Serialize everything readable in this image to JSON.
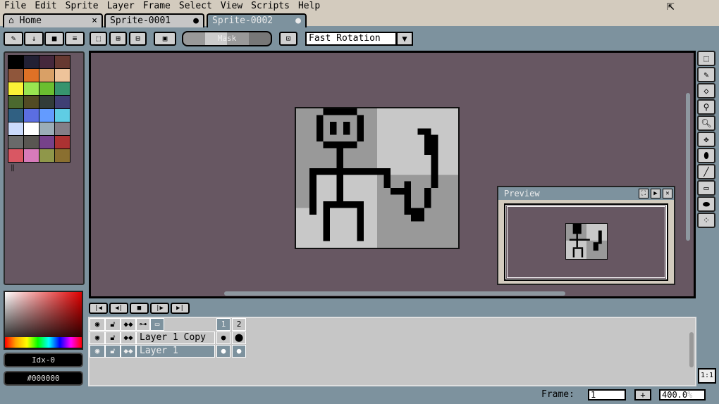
{
  "menu": [
    "File",
    "Edit",
    "Sprite",
    "Layer",
    "Frame",
    "Select",
    "View",
    "Scripts",
    "Help"
  ],
  "tabs": [
    {
      "label": "Home",
      "mark": "×"
    },
    {
      "label": "Sprite-0001",
      "mark": "●"
    },
    {
      "label": "Sprite-0002",
      "mark": "●"
    }
  ],
  "toolbar": {
    "mask_label": "Mask",
    "rotation": "Fast Rotation"
  },
  "palette": [
    "#000000",
    "#222034",
    "#45283c",
    "#663931",
    "#8f563b",
    "#df7126",
    "#d9a066",
    "#eec39a",
    "#fbf236",
    "#99e550",
    "#6abe30",
    "#37946e",
    "#4b692f",
    "#524b24",
    "#323c39",
    "#3f3f74",
    "#306082",
    "#5b6ee1",
    "#639bff",
    "#5fcde4",
    "#cbdbfc",
    "#ffffff",
    "#9badb7",
    "#847e87",
    "#696a6a",
    "#595652",
    "#76428a",
    "#ac3232",
    "#d95763",
    "#d77bba",
    "#8f974a",
    "#8a6f30"
  ],
  "color": {
    "index": "Idx-0",
    "hex": "#000000"
  },
  "preview": {
    "title": "Preview"
  },
  "timeline": {
    "frames": [
      "1",
      "2"
    ],
    "layers": [
      {
        "name": "Layer 1 Copy"
      },
      {
        "name": "Layer 1"
      }
    ]
  },
  "status": {
    "frame_label": "Frame:",
    "frame": "1",
    "zoom": "400.0",
    "zoom_unit": "%",
    "one_to_one": "1:1"
  }
}
